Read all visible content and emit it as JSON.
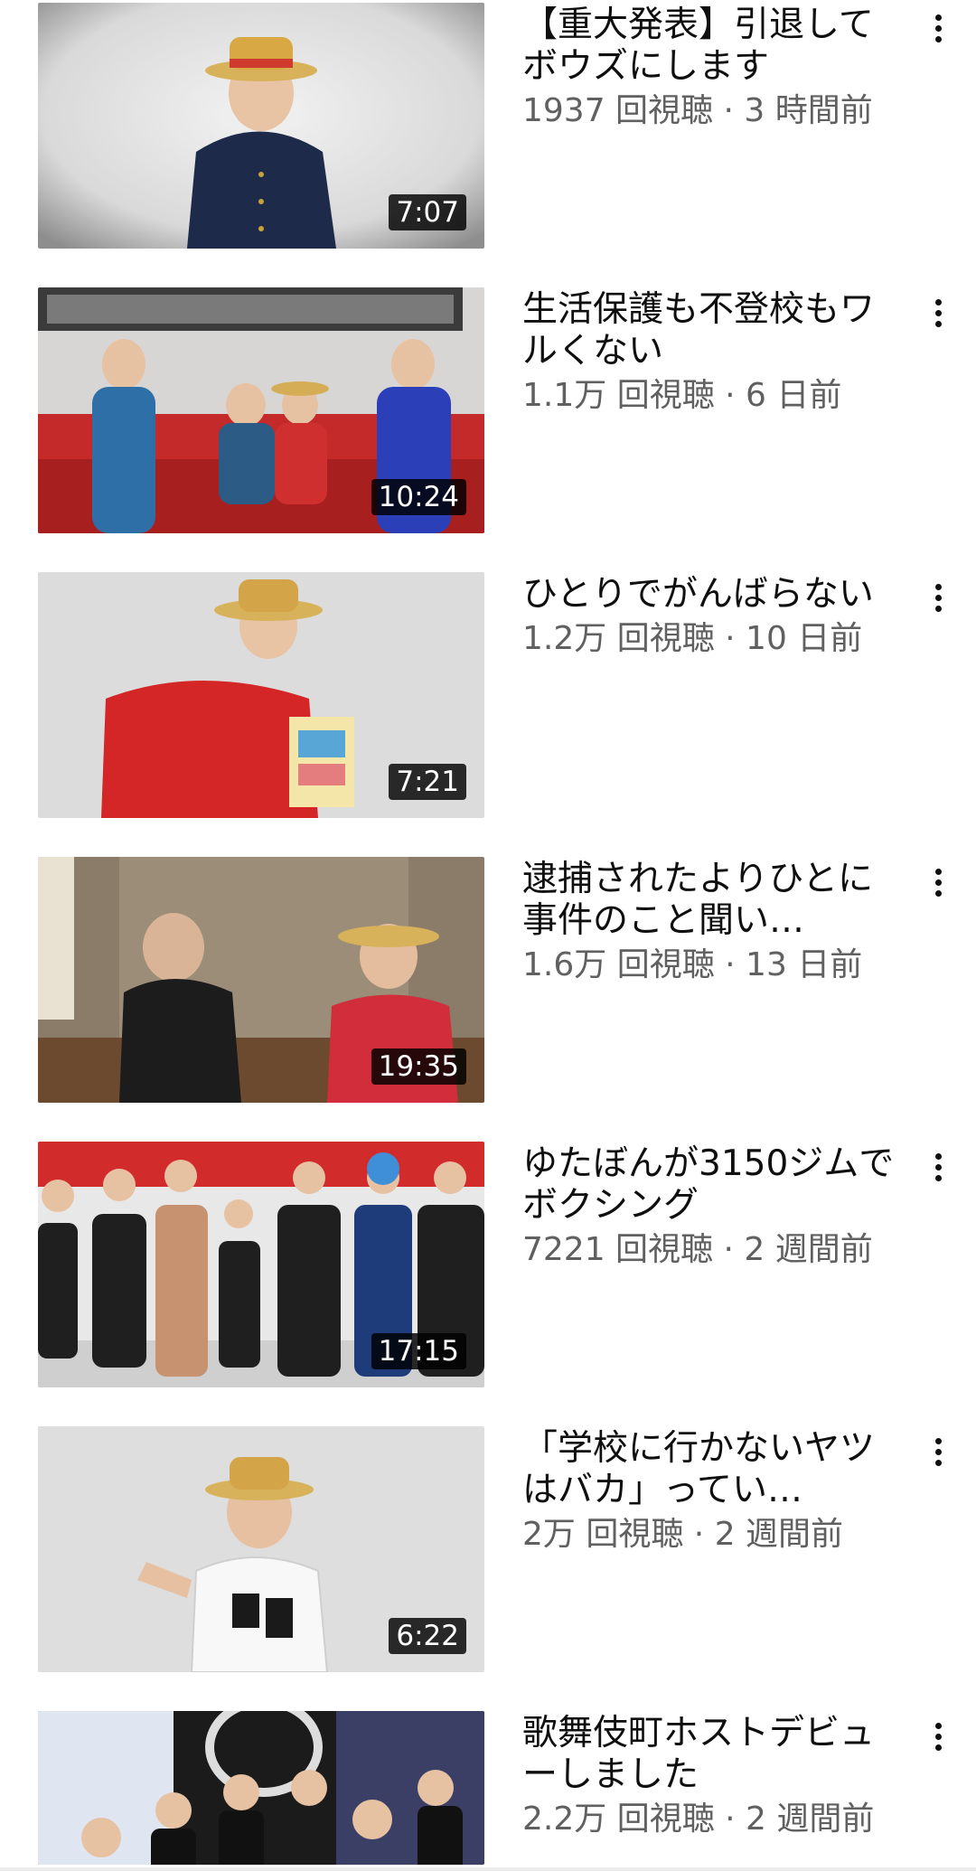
{
  "videos": [
    {
      "title": "【重大発表】引退してボウズにします",
      "views": "1937 回視聴",
      "age": "3 時間前",
      "duration": "7:07"
    },
    {
      "title": "生活保護も不登校もワルくない",
      "views": "1.1万 回視聴",
      "age": "6 日前",
      "duration": "10:24"
    },
    {
      "title": "ひとりでがんばらない",
      "views": "1.2万 回視聴",
      "age": "10 日前",
      "duration": "7:21"
    },
    {
      "title": "逮捕されたよりひとに事件のこと聞い…",
      "views": "1.6万 回視聴",
      "age": "13 日前",
      "duration": "19:35"
    },
    {
      "title": "ゆたぼんが3150ジムでボクシング",
      "views": "7221 回視聴",
      "age": "2 週間前",
      "duration": "17:15"
    },
    {
      "title": "「学校に行かないヤツはバカ」ってい…",
      "views": "2万 回視聴",
      "age": "2 週間前",
      "duration": "6:22"
    },
    {
      "title": "歌舞伎町ホストデビューしました",
      "views": "2.2万 回視聴",
      "age": "2 週間前",
      "duration": ""
    }
  ],
  "separator": " · ",
  "icons": {
    "menu": "more-vert-icon"
  }
}
